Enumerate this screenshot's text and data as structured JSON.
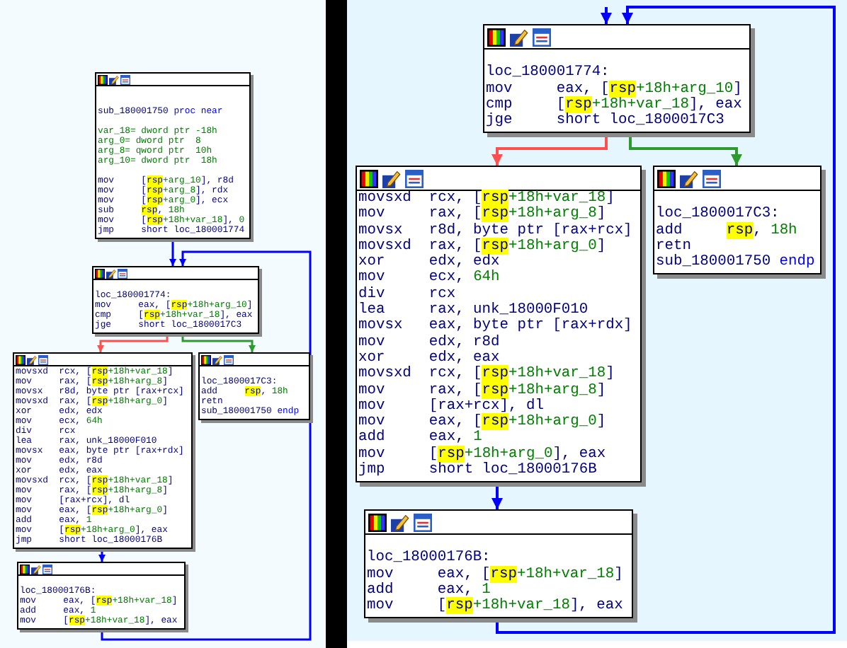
{
  "panels": [
    {
      "nodes": [
        {
          "sections": [
            [
              {
                "parts": [
                  {
                    "text": "sub_180001750 ",
                    "kind": "reg"
                  },
                  {
                    "text": "proc near",
                    "kind": "keyword"
                  }
                ]
              }
            ],
            [
              {
                "parts": [
                  {
                    "text": "var_18= dword ptr -18h",
                    "kind": "value"
                  }
                ]
              },
              {
                "parts": [
                  {
                    "text": "arg_0= dword ptr  8",
                    "kind": "value"
                  }
                ]
              },
              {
                "parts": [
                  {
                    "text": "arg_8= qword ptr  10h",
                    "kind": "value"
                  }
                ]
              },
              {
                "parts": [
                  {
                    "text": "arg_10= dword ptr  18h",
                    "kind": "value"
                  }
                ]
              }
            ],
            [
              {
                "op": "mov",
                "args": [
                  {
                    "text": "[",
                    "kind": "reg"
                  },
                  {
                    "text": "rsp",
                    "kind": "stack"
                  },
                  {
                    "text": "+arg_10",
                    "kind": "value"
                  },
                  {
                    "text": "], r8d",
                    "kind": "reg"
                  }
                ]
              },
              {
                "op": "mov",
                "args": [
                  {
                    "text": "[",
                    "kind": "reg"
                  },
                  {
                    "text": "rsp",
                    "kind": "stack"
                  },
                  {
                    "text": "+arg_8",
                    "kind": "value"
                  },
                  {
                    "text": "], rdx",
                    "kind": "reg"
                  }
                ]
              },
              {
                "op": "mov",
                "args": [
                  {
                    "text": "[",
                    "kind": "reg"
                  },
                  {
                    "text": "rsp",
                    "kind": "stack"
                  },
                  {
                    "text": "+arg_0",
                    "kind": "value"
                  },
                  {
                    "text": "], ecx",
                    "kind": "reg"
                  }
                ]
              },
              {
                "op": "sub",
                "args": [
                  {
                    "text": "rsp",
                    "kind": "stack"
                  },
                  {
                    "text": ", ",
                    "kind": "reg"
                  },
                  {
                    "text": "18h",
                    "kind": "value"
                  }
                ]
              },
              {
                "op": "mov",
                "args": [
                  {
                    "text": "[",
                    "kind": "reg"
                  },
                  {
                    "text": "rsp",
                    "kind": "stack"
                  },
                  {
                    "text": "+18h+var_18",
                    "kind": "value"
                  },
                  {
                    "text": "], ",
                    "kind": "reg"
                  },
                  {
                    "text": "0",
                    "kind": "value"
                  }
                ]
              },
              {
                "op": "jmp",
                "args": [
                  {
                    "text": "short loc_180001774",
                    "kind": "reg"
                  }
                ]
              }
            ]
          ]
        },
        {
          "sections": [
            [
              {
                "parts": [
                  {
                    "text": "loc_180001774:",
                    "kind": "reg"
                  }
                ]
              },
              {
                "op": "mov",
                "args": [
                  {
                    "text": "eax, [",
                    "kind": "reg"
                  },
                  {
                    "text": "rsp",
                    "kind": "stack"
                  },
                  {
                    "text": "+18h+arg_10",
                    "kind": "value"
                  },
                  {
                    "text": "]",
                    "kind": "reg"
                  }
                ]
              },
              {
                "op": "cmp",
                "args": [
                  {
                    "text": "[",
                    "kind": "reg"
                  },
                  {
                    "text": "rsp",
                    "kind": "stack"
                  },
                  {
                    "text": "+18h+var_18",
                    "kind": "value"
                  },
                  {
                    "text": "], eax",
                    "kind": "reg"
                  }
                ]
              },
              {
                "op": "jge",
                "args": [
                  {
                    "text": "short loc_1800017C3",
                    "kind": "reg"
                  }
                ]
              }
            ]
          ]
        },
        {
          "sections": [
            [
              {
                "op": "movsxd",
                "args": [
                  {
                    "text": "rcx, [",
                    "kind": "reg"
                  },
                  {
                    "text": "rsp",
                    "kind": "stack"
                  },
                  {
                    "text": "+18h+var_18",
                    "kind": "value"
                  },
                  {
                    "text": "]",
                    "kind": "reg"
                  }
                ]
              },
              {
                "op": "mov",
                "args": [
                  {
                    "text": "rax, [",
                    "kind": "reg"
                  },
                  {
                    "text": "rsp",
                    "kind": "stack"
                  },
                  {
                    "text": "+18h+arg_8",
                    "kind": "value"
                  },
                  {
                    "text": "]",
                    "kind": "reg"
                  }
                ]
              },
              {
                "op": "movsx",
                "args": [
                  {
                    "text": "r8d, byte ptr [rax+rcx]",
                    "kind": "reg"
                  }
                ]
              },
              {
                "op": "movsxd",
                "args": [
                  {
                    "text": "rax, [",
                    "kind": "reg"
                  },
                  {
                    "text": "rsp",
                    "kind": "stack"
                  },
                  {
                    "text": "+18h+arg_0",
                    "kind": "value"
                  },
                  {
                    "text": "]",
                    "kind": "reg"
                  }
                ]
              },
              {
                "op": "xor",
                "args": [
                  {
                    "text": "edx, edx",
                    "kind": "reg"
                  }
                ]
              },
              {
                "op": "mov",
                "args": [
                  {
                    "text": "ecx, ",
                    "kind": "reg"
                  },
                  {
                    "text": "64h",
                    "kind": "value"
                  }
                ]
              },
              {
                "op": "div",
                "args": [
                  {
                    "text": "rcx",
                    "kind": "reg"
                  }
                ]
              },
              {
                "op": "lea",
                "args": [
                  {
                    "text": "rax, unk_18000F010",
                    "kind": "reg"
                  }
                ]
              },
              {
                "op": "movsx",
                "args": [
                  {
                    "text": "eax, byte ptr [rax+rdx]",
                    "kind": "reg"
                  }
                ]
              },
              {
                "op": "mov",
                "args": [
                  {
                    "text": "edx, r8d",
                    "kind": "reg"
                  }
                ]
              },
              {
                "op": "xor",
                "args": [
                  {
                    "text": "edx, eax",
                    "kind": "reg"
                  }
                ]
              },
              {
                "op": "movsxd",
                "args": [
                  {
                    "text": "rcx, [",
                    "kind": "reg"
                  },
                  {
                    "text": "rsp",
                    "kind": "stack"
                  },
                  {
                    "text": "+18h+var_18",
                    "kind": "value"
                  },
                  {
                    "text": "]",
                    "kind": "reg"
                  }
                ]
              },
              {
                "op": "mov",
                "args": [
                  {
                    "text": "rax, [",
                    "kind": "reg"
                  },
                  {
                    "text": "rsp",
                    "kind": "stack"
                  },
                  {
                    "text": "+18h+arg_8",
                    "kind": "value"
                  },
                  {
                    "text": "]",
                    "kind": "reg"
                  }
                ]
              },
              {
                "op": "mov",
                "args": [
                  {
                    "text": "[rax+rcx], dl",
                    "kind": "reg"
                  }
                ]
              },
              {
                "op": "mov",
                "args": [
                  {
                    "text": "eax, [",
                    "kind": "reg"
                  },
                  {
                    "text": "rsp",
                    "kind": "stack"
                  },
                  {
                    "text": "+18h+arg_0",
                    "kind": "value"
                  },
                  {
                    "text": "]",
                    "kind": "reg"
                  }
                ]
              },
              {
                "op": "add",
                "args": [
                  {
                    "text": "eax, ",
                    "kind": "reg"
                  },
                  {
                    "text": "1",
                    "kind": "value"
                  }
                ]
              },
              {
                "op": "mov",
                "args": [
                  {
                    "text": "[",
                    "kind": "reg"
                  },
                  {
                    "text": "rsp",
                    "kind": "stack"
                  },
                  {
                    "text": "+18h+arg_0",
                    "kind": "value"
                  },
                  {
                    "text": "], eax",
                    "kind": "reg"
                  }
                ]
              },
              {
                "op": "jmp",
                "args": [
                  {
                    "text": "short loc_18000176B",
                    "kind": "reg"
                  }
                ]
              }
            ]
          ]
        },
        {
          "sections": [
            [
              {
                "parts": [
                  {
                    "text": "loc_1800017C3:",
                    "kind": "reg"
                  }
                ]
              },
              {
                "op": "add",
                "args": [
                  {
                    "text": "rsp",
                    "kind": "stack"
                  },
                  {
                    "text": ", ",
                    "kind": "reg"
                  },
                  {
                    "text": "18h",
                    "kind": "value"
                  }
                ]
              },
              {
                "op": "retn"
              },
              {
                "parts": [
                  {
                    "text": "sub_180001750 ",
                    "kind": "reg"
                  },
                  {
                    "text": "endp",
                    "kind": "keyword"
                  }
                ]
              }
            ]
          ]
        },
        {
          "sections": [
            [
              {
                "parts": [
                  {
                    "text": "loc_18000176B:",
                    "kind": "reg"
                  }
                ]
              },
              {
                "op": "mov",
                "args": [
                  {
                    "text": "eax, [",
                    "kind": "reg"
                  },
                  {
                    "text": "rsp",
                    "kind": "stack"
                  },
                  {
                    "text": "+18h+var_18",
                    "kind": "value"
                  },
                  {
                    "text": "]",
                    "kind": "reg"
                  }
                ]
              },
              {
                "op": "add",
                "args": [
                  {
                    "text": "eax, ",
                    "kind": "reg"
                  },
                  {
                    "text": "1",
                    "kind": "value"
                  }
                ]
              },
              {
                "op": "mov",
                "args": [
                  {
                    "text": "[",
                    "kind": "reg"
                  },
                  {
                    "text": "rsp",
                    "kind": "stack"
                  },
                  {
                    "text": "+18h+var_18",
                    "kind": "value"
                  },
                  {
                    "text": "], eax",
                    "kind": "reg"
                  }
                ]
              }
            ]
          ]
        }
      ]
    },
    {
      "nodes": [
        {
          "sections": [
            [
              {
                "parts": [
                  {
                    "text": "loc_180001774:",
                    "kind": "reg"
                  }
                ]
              },
              {
                "op": "mov",
                "args": [
                  {
                    "text": "eax, [",
                    "kind": "reg"
                  },
                  {
                    "text": "rsp",
                    "kind": "stack"
                  },
                  {
                    "text": "+18h+arg_10",
                    "kind": "value"
                  },
                  {
                    "text": "]",
                    "kind": "reg"
                  }
                ]
              },
              {
                "op": "cmp",
                "args": [
                  {
                    "text": "[",
                    "kind": "reg"
                  },
                  {
                    "text": "rsp",
                    "kind": "stack"
                  },
                  {
                    "text": "+18h+var_18",
                    "kind": "value"
                  },
                  {
                    "text": "], eax",
                    "kind": "reg"
                  }
                ]
              },
              {
                "op": "jge",
                "args": [
                  {
                    "text": "short loc_1800017C3",
                    "kind": "reg"
                  }
                ]
              }
            ]
          ]
        },
        {
          "sections": [
            [
              {
                "op": "movsxd",
                "args": [
                  {
                    "text": "rcx, [",
                    "kind": "reg"
                  },
                  {
                    "text": "rsp",
                    "kind": "stack"
                  },
                  {
                    "text": "+18h+var_18",
                    "kind": "value"
                  },
                  {
                    "text": "]",
                    "kind": "reg"
                  }
                ]
              },
              {
                "op": "mov",
                "args": [
                  {
                    "text": "rax, [",
                    "kind": "reg"
                  },
                  {
                    "text": "rsp",
                    "kind": "stack"
                  },
                  {
                    "text": "+18h+arg_8",
                    "kind": "value"
                  },
                  {
                    "text": "]",
                    "kind": "reg"
                  }
                ]
              },
              {
                "op": "movsx",
                "args": [
                  {
                    "text": "r8d, byte ptr [rax+rcx]",
                    "kind": "reg"
                  }
                ]
              },
              {
                "op": "movsxd",
                "args": [
                  {
                    "text": "rax, [",
                    "kind": "reg"
                  },
                  {
                    "text": "rsp",
                    "kind": "stack"
                  },
                  {
                    "text": "+18h+arg_0",
                    "kind": "value"
                  },
                  {
                    "text": "]",
                    "kind": "reg"
                  }
                ]
              },
              {
                "op": "xor",
                "args": [
                  {
                    "text": "edx, edx",
                    "kind": "reg"
                  }
                ]
              },
              {
                "op": "mov",
                "args": [
                  {
                    "text": "ecx, ",
                    "kind": "reg"
                  },
                  {
                    "text": "64h",
                    "kind": "value"
                  }
                ]
              },
              {
                "op": "div",
                "args": [
                  {
                    "text": "rcx",
                    "kind": "reg"
                  }
                ]
              },
              {
                "op": "lea",
                "args": [
                  {
                    "text": "rax, unk_18000F010",
                    "kind": "reg"
                  }
                ]
              },
              {
                "op": "movsx",
                "args": [
                  {
                    "text": "eax, byte ptr [rax+rdx]",
                    "kind": "reg"
                  }
                ]
              },
              {
                "op": "mov",
                "args": [
                  {
                    "text": "edx, r8d",
                    "kind": "reg"
                  }
                ]
              },
              {
                "op": "xor",
                "args": [
                  {
                    "text": "edx, eax",
                    "kind": "reg"
                  }
                ]
              },
              {
                "op": "movsxd",
                "args": [
                  {
                    "text": "rcx, [",
                    "kind": "reg"
                  },
                  {
                    "text": "rsp",
                    "kind": "stack"
                  },
                  {
                    "text": "+18h+var_18",
                    "kind": "value"
                  },
                  {
                    "text": "]",
                    "kind": "reg"
                  }
                ]
              },
              {
                "op": "mov",
                "args": [
                  {
                    "text": "rax, [",
                    "kind": "reg"
                  },
                  {
                    "text": "rsp",
                    "kind": "stack"
                  },
                  {
                    "text": "+18h+arg_8",
                    "kind": "value"
                  },
                  {
                    "text": "]",
                    "kind": "reg"
                  }
                ]
              },
              {
                "op": "mov",
                "args": [
                  {
                    "text": "[rax+rcx], dl",
                    "kind": "reg"
                  }
                ]
              },
              {
                "op": "mov",
                "args": [
                  {
                    "text": "eax, [",
                    "kind": "reg"
                  },
                  {
                    "text": "rsp",
                    "kind": "stack"
                  },
                  {
                    "text": "+18h+arg_0",
                    "kind": "value"
                  },
                  {
                    "text": "]",
                    "kind": "reg"
                  }
                ]
              },
              {
                "op": "add",
                "args": [
                  {
                    "text": "eax, ",
                    "kind": "reg"
                  },
                  {
                    "text": "1",
                    "kind": "value"
                  }
                ]
              },
              {
                "op": "mov",
                "args": [
                  {
                    "text": "[",
                    "kind": "reg"
                  },
                  {
                    "text": "rsp",
                    "kind": "stack"
                  },
                  {
                    "text": "+18h+arg_0",
                    "kind": "value"
                  },
                  {
                    "text": "], eax",
                    "kind": "reg"
                  }
                ]
              },
              {
                "op": "jmp",
                "args": [
                  {
                    "text": "short loc_18000176B",
                    "kind": "reg"
                  }
                ]
              }
            ]
          ]
        },
        {
          "sections": [
            [
              {
                "parts": [
                  {
                    "text": "loc_1800017C3:",
                    "kind": "reg"
                  }
                ]
              },
              {
                "op": "add",
                "args": [
                  {
                    "text": "rsp",
                    "kind": "stack"
                  },
                  {
                    "text": ", ",
                    "kind": "reg"
                  },
                  {
                    "text": "18h",
                    "kind": "value"
                  }
                ]
              },
              {
                "op": "retn"
              },
              {
                "parts": [
                  {
                    "text": "sub_180001750 ",
                    "kind": "reg"
                  },
                  {
                    "text": "endp",
                    "kind": "keyword"
                  }
                ]
              }
            ]
          ]
        },
        {
          "sections": [
            [
              {
                "parts": [
                  {
                    "text": "loc_18000176B:",
                    "kind": "reg"
                  }
                ]
              },
              {
                "op": "mov",
                "args": [
                  {
                    "text": "eax, [",
                    "kind": "reg"
                  },
                  {
                    "text": "rsp",
                    "kind": "stack"
                  },
                  {
                    "text": "+18h+var_18",
                    "kind": "value"
                  },
                  {
                    "text": "]",
                    "kind": "reg"
                  }
                ]
              },
              {
                "op": "add",
                "args": [
                  {
                    "text": "eax, ",
                    "kind": "reg"
                  },
                  {
                    "text": "1",
                    "kind": "value"
                  }
                ]
              },
              {
                "op": "mov",
                "args": [
                  {
                    "text": "[",
                    "kind": "reg"
                  },
                  {
                    "text": "rsp",
                    "kind": "stack"
                  },
                  {
                    "text": "+18h+var_18",
                    "kind": "value"
                  },
                  {
                    "text": "], eax",
                    "kind": "reg"
                  }
                ]
              }
            ]
          ]
        }
      ]
    }
  ]
}
